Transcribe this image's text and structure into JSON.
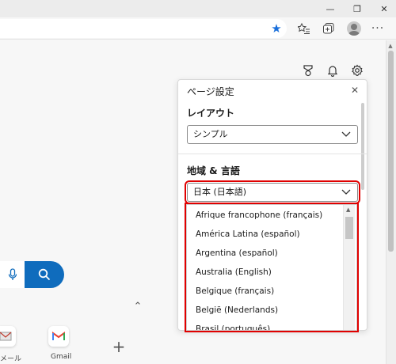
{
  "window": {
    "minimize": "—",
    "restore": "❐",
    "close": "✕"
  },
  "toolbar": {
    "favorite_icon": "star-filled-icon",
    "favorites_icon": "favorites-list-icon",
    "collections_icon": "collections-icon",
    "profile_icon": "profile-avatar-icon"
  },
  "newtab": {
    "icons": [
      "rewards-icon",
      "notifications-bell-icon",
      "settings-gear-icon"
    ],
    "collapse_symbol": "⌃",
    "add_symbol": "+",
    "quick_links": [
      {
        "label": "メール"
      },
      {
        "label": "Gmail"
      }
    ]
  },
  "settings_panel": {
    "title": "ページ設定",
    "close_symbol": "✕",
    "layout_label": "レイアウト",
    "layout_value": "シンプル",
    "region_label": "地域 & 言語",
    "region_value": "日本 (日本語)",
    "region_options": [
      "Afrique francophone (français)",
      "América Latina (español)",
      "Argentina (español)",
      "Australia (English)",
      "Belgique (français)",
      "België (Nederlands)",
      "Brasil (português)"
    ]
  },
  "colors": {
    "accent": "#0f6cbd",
    "highlight": "#e00000",
    "star": "#1a6fdb"
  }
}
